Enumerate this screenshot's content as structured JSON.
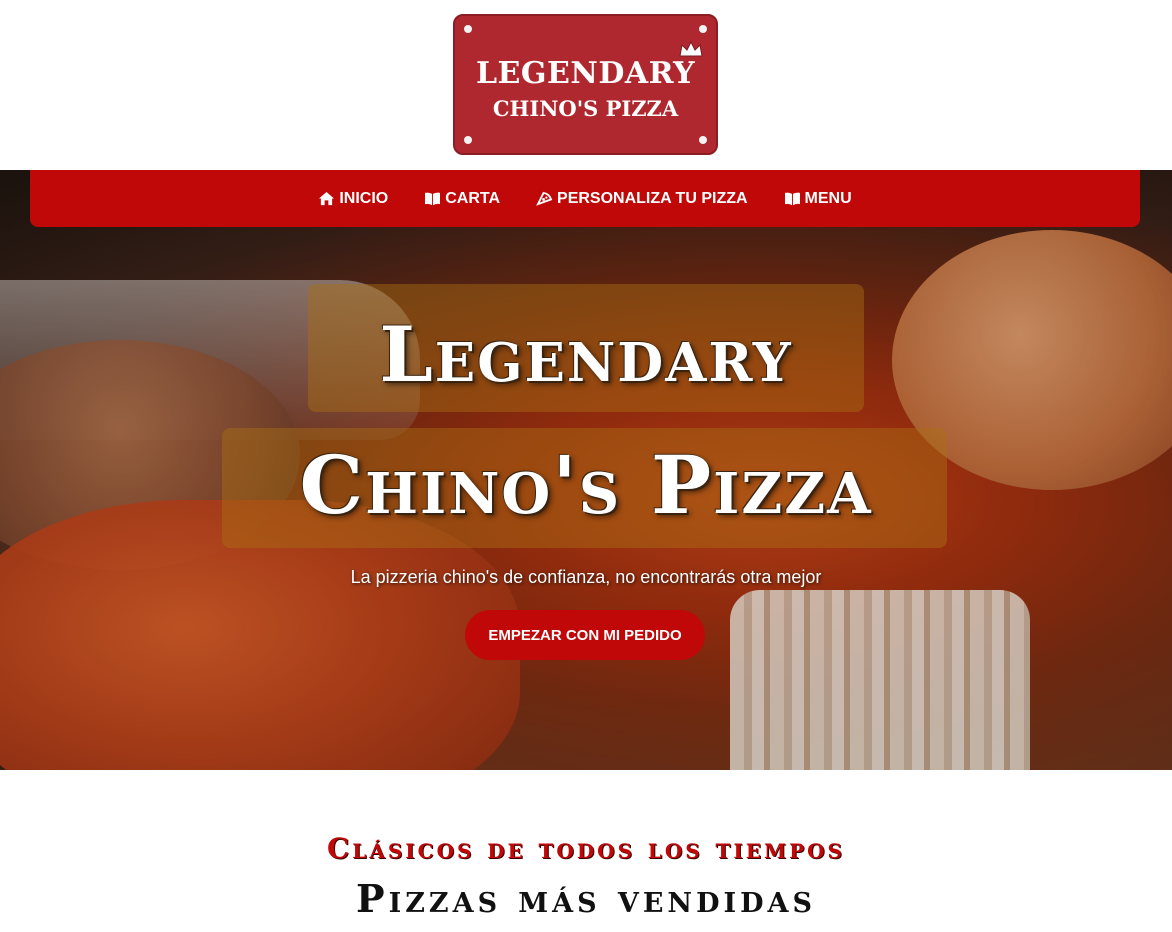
{
  "logo": {
    "line1": "LEGENDARY",
    "line2": "CHINO'S PIZZA",
    "color": "#b0282f"
  },
  "nav": {
    "items": [
      {
        "label": "INICIO",
        "icon": "home-icon"
      },
      {
        "label": "CARTA",
        "icon": "book-icon"
      },
      {
        "label": "PERSONALIZA TU PIZZA",
        "icon": "pizza-icon"
      },
      {
        "label": "MENU",
        "icon": "book-icon"
      }
    ],
    "color": "#c10808"
  },
  "hero": {
    "title_line1": "Legendary",
    "title_line2": "Chino's Pizza",
    "tagline": "La pizzeria chino's de confianza, no encontrarás otra mejor",
    "cta_label": "EMPEZAR CON MI PEDIDO"
  },
  "section": {
    "subtitle": "Clásicos de todos los tiempos",
    "title": "Pizzas más vendidas",
    "accent": "#c10808"
  }
}
